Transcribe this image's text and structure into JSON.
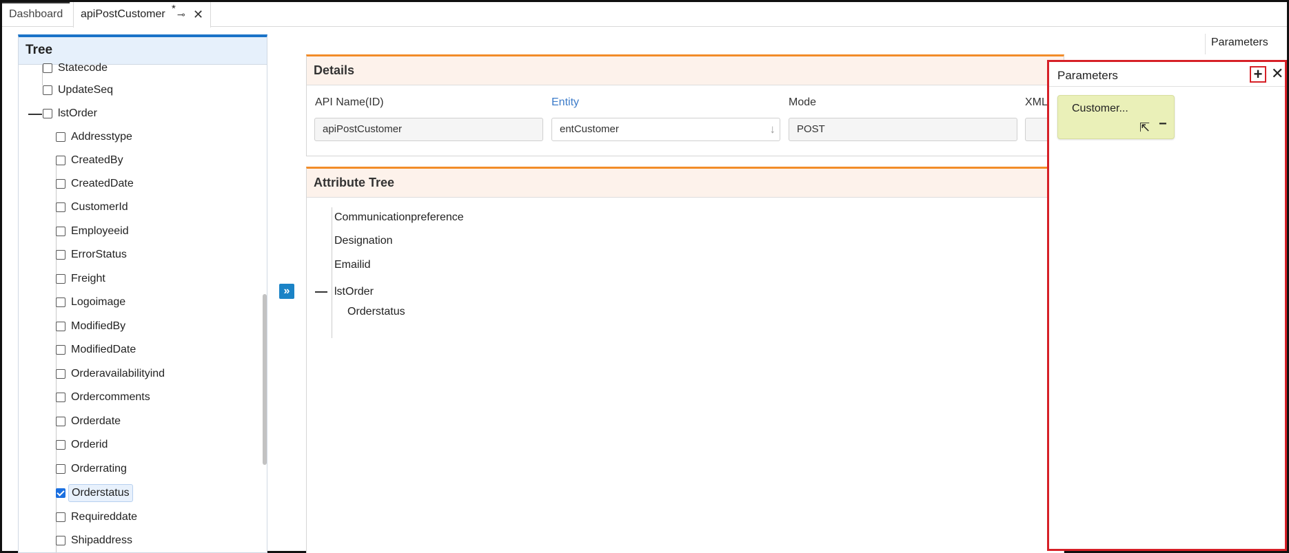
{
  "tabs": [
    {
      "label": "Dashboard"
    },
    {
      "label": "apiPostCustomer",
      "modified_marker": "*"
    }
  ],
  "tree": {
    "title": "Tree",
    "items": [
      {
        "label": "Statecode",
        "level": 1,
        "checked": false
      },
      {
        "label": "UpdateSeq",
        "level": 1,
        "checked": false
      },
      {
        "label": "lstOrder",
        "level": 1,
        "checked": false,
        "expanded": true
      },
      {
        "label": "Addresstype",
        "level": 2,
        "checked": false
      },
      {
        "label": "CreatedBy",
        "level": 2,
        "checked": false
      },
      {
        "label": "CreatedDate",
        "level": 2,
        "checked": false
      },
      {
        "label": "CustomerId",
        "level": 2,
        "checked": false
      },
      {
        "label": "Employeeid",
        "level": 2,
        "checked": false
      },
      {
        "label": "ErrorStatus",
        "level": 2,
        "checked": false
      },
      {
        "label": "Freight",
        "level": 2,
        "checked": false
      },
      {
        "label": "Logoimage",
        "level": 2,
        "checked": false
      },
      {
        "label": "ModifiedBy",
        "level": 2,
        "checked": false
      },
      {
        "label": "ModifiedDate",
        "level": 2,
        "checked": false
      },
      {
        "label": "Orderavailabilityind",
        "level": 2,
        "checked": false
      },
      {
        "label": "Ordercomments",
        "level": 2,
        "checked": false
      },
      {
        "label": "Orderdate",
        "level": 2,
        "checked": false
      },
      {
        "label": "Orderid",
        "level": 2,
        "checked": false
      },
      {
        "label": "Orderrating",
        "level": 2,
        "checked": false
      },
      {
        "label": "Orderstatus",
        "level": 2,
        "checked": true,
        "selected": true
      },
      {
        "label": "Requireddate",
        "level": 2,
        "checked": false
      },
      {
        "label": "Shipaddress",
        "level": 2,
        "checked": false
      }
    ]
  },
  "right_tab": {
    "label": "Parameters"
  },
  "details": {
    "title": "Details",
    "api_name_label": "API Name(ID)",
    "api_name_value": "apiPostCustomer",
    "entity_label": "Entity",
    "entity_value": "entCustomer",
    "mode_label": "Mode",
    "mode_value": "POST",
    "xml_label": "XML"
  },
  "attribute_tree": {
    "title": "Attribute Tree",
    "items": [
      {
        "label": "Communicationpreference"
      },
      {
        "label": "Designation"
      },
      {
        "label": "Emailid"
      },
      {
        "label": "lstOrder"
      },
      {
        "label": "Orderstatus"
      }
    ]
  },
  "parameters_panel": {
    "title": "Parameters",
    "add_icon": "+",
    "close_icon": "✕",
    "items": [
      {
        "label": "Customer..."
      }
    ]
  },
  "colors": {
    "tree_accent": "#1a73c8",
    "section_accent": "#f28c28",
    "highlight_border": "#d62027",
    "param_card_bg": "#eaf0b8",
    "expand_button": "#1b83c6"
  }
}
